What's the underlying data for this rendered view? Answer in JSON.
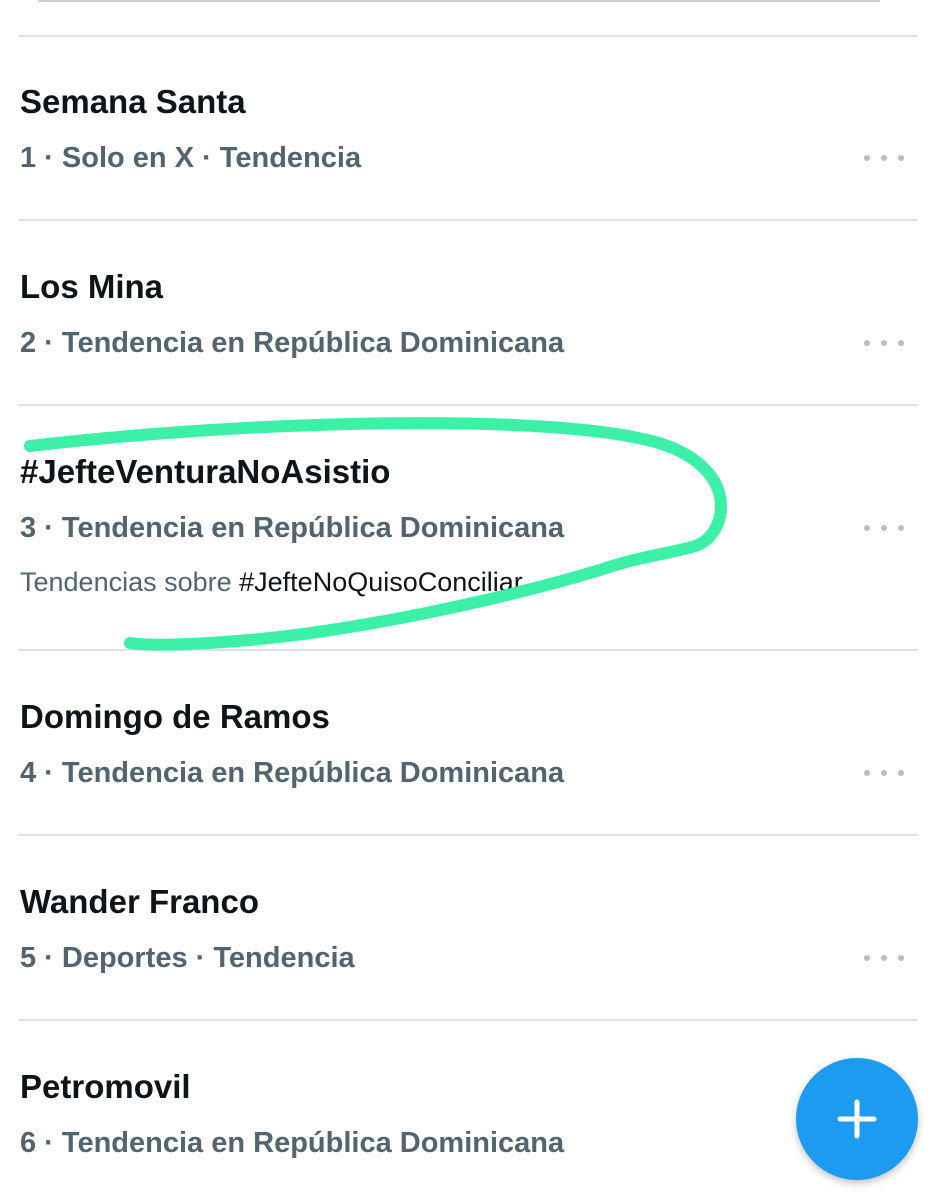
{
  "trends": [
    {
      "title": "Semana Santa",
      "meta": "1 · Solo en X · Tendencia"
    },
    {
      "title": "Los Mina",
      "meta": "2 · Tendencia en República Dominicana"
    },
    {
      "title": "#JefteVenturaNoAsistio",
      "meta": "3 · Tendencia en República Dominicana",
      "sub_prefix": "Tendencias sobre ",
      "sub_tag": "#JefteNoQuisoConciliar"
    },
    {
      "title": "Domingo de Ramos",
      "meta": "4 · Tendencia en República Dominicana"
    },
    {
      "title": "Wander Franco",
      "meta": "5 · Deportes · Tendencia"
    },
    {
      "title": "Petromovil",
      "meta": "6 · Tendencia en República Dominicana"
    }
  ],
  "icons": {
    "more": "more-horizontal-icon",
    "fab": "plus-icon"
  },
  "colors": {
    "accent": "#1d9bf0",
    "highlight_marker": "#3df0a8",
    "title_text": "#0f1419",
    "meta_text": "#536471"
  }
}
